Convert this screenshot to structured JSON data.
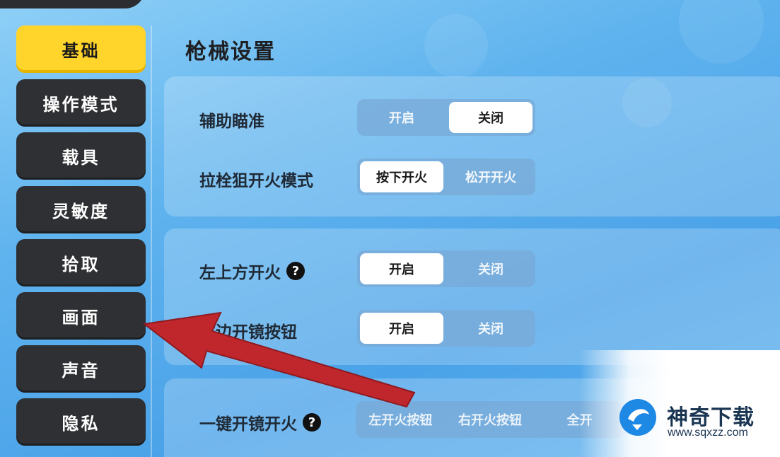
{
  "sidebar": {
    "items": [
      {
        "label": "基础",
        "active": true
      },
      {
        "label": "操作模式",
        "active": false
      },
      {
        "label": "载具",
        "active": false
      },
      {
        "label": "灵敏度",
        "active": false
      },
      {
        "label": "拾取",
        "active": false
      },
      {
        "label": "画面",
        "active": false
      },
      {
        "label": "声音",
        "active": false
      },
      {
        "label": "隐私",
        "active": false
      }
    ]
  },
  "main": {
    "section_title": "枪械设置",
    "rows": [
      {
        "label": "辅助瞄准",
        "options": [
          "开启",
          "关闭"
        ],
        "selected": 1
      },
      {
        "label": "拉栓狙开火模式",
        "options": [
          "按下开火",
          "松开开火"
        ],
        "selected": 0
      },
      {
        "label": "左上方开火",
        "options": [
          "开启",
          "关闭"
        ],
        "selected": 0,
        "help": "?"
      },
      {
        "label": "左边开镜按钮",
        "options": [
          "开启",
          "关闭"
        ],
        "selected": 0
      },
      {
        "label": "一键开镜开火",
        "options": [
          "左开火按钮",
          "右开火按钮",
          "全开"
        ],
        "help": "?"
      }
    ]
  },
  "watermark": {
    "title": "神奇下载",
    "url": "www.sqxzz.com"
  },
  "colors": {
    "active_tab": "#ffd42b",
    "tab_bg": "#2f3033",
    "arrow": "#c0272d"
  },
  "annotation": "red-arrow-pointing-to-画面"
}
